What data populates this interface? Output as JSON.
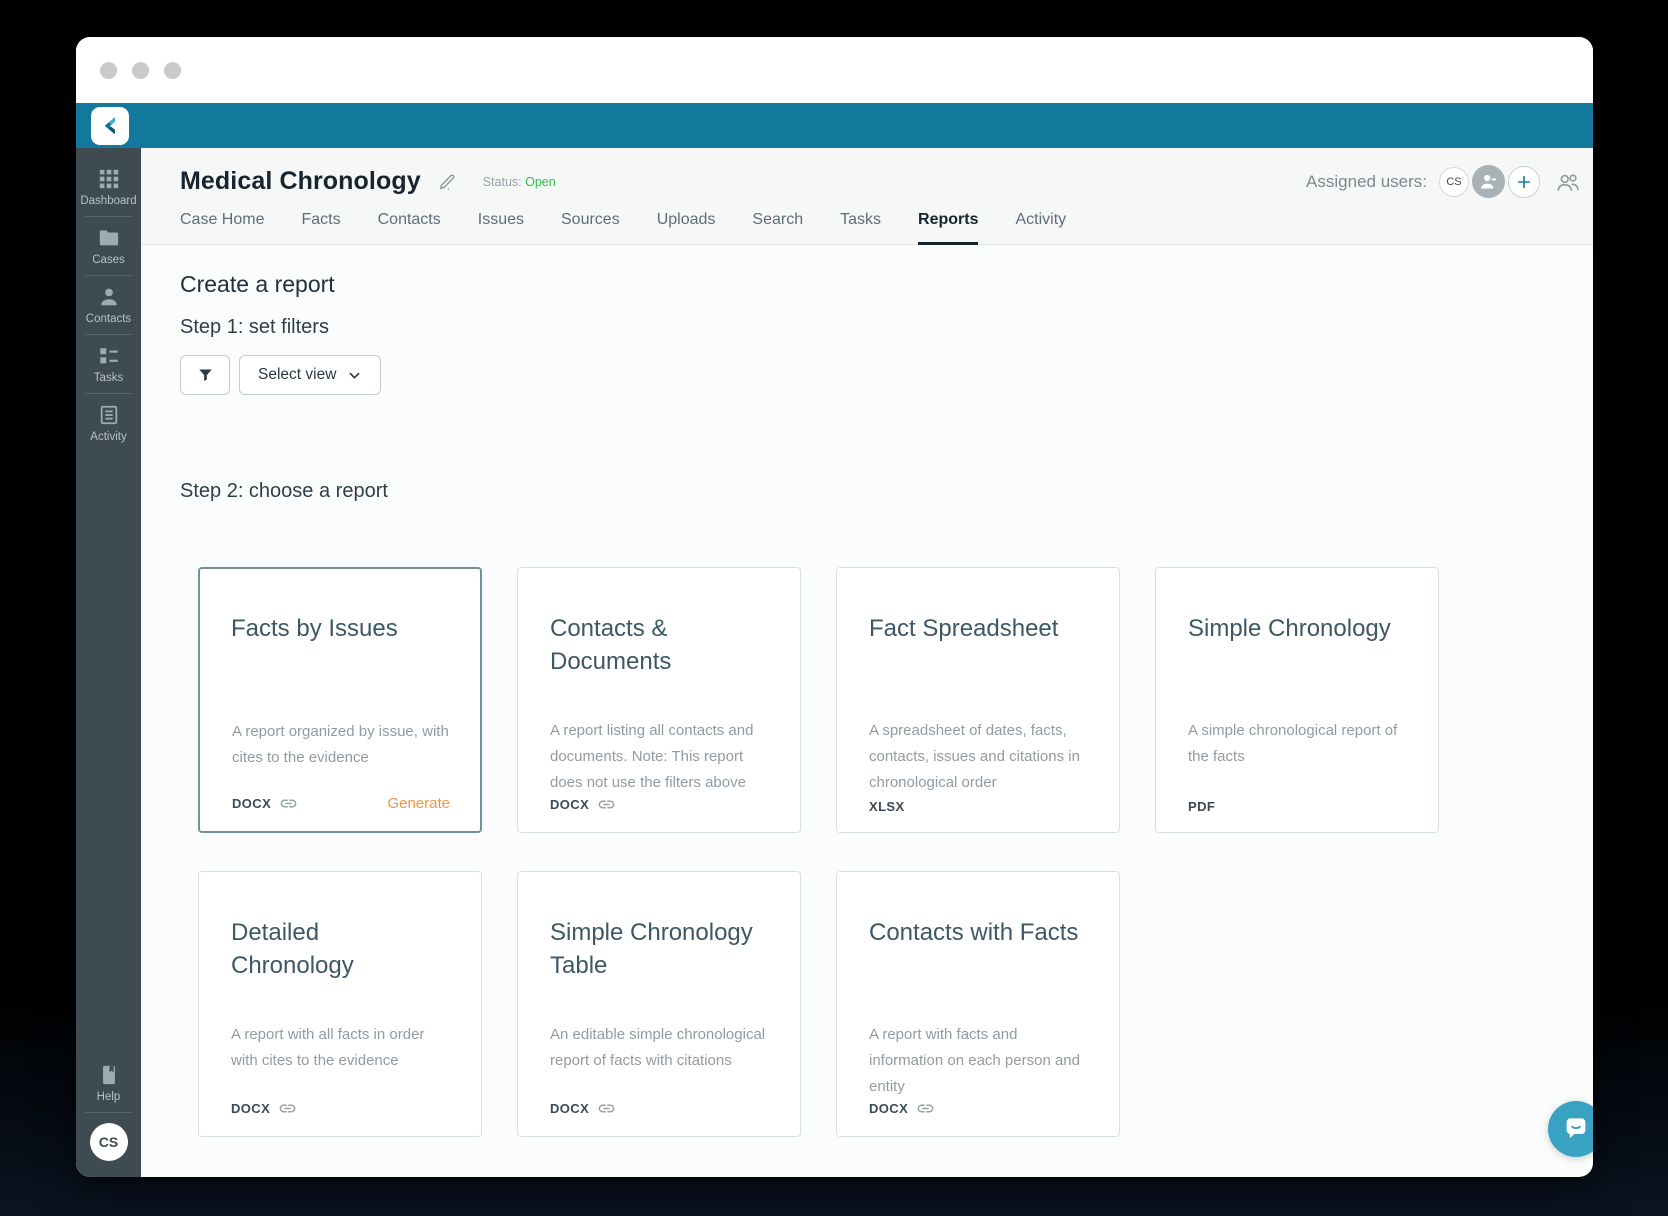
{
  "header": {
    "case_title": "Medical Chronology",
    "status_label": "Status:",
    "status_value": "Open",
    "assigned_users_label": "Assigned users:",
    "assigned_user_initials": "CS"
  },
  "tabs": [
    {
      "label": "Case Home"
    },
    {
      "label": "Facts"
    },
    {
      "label": "Contacts"
    },
    {
      "label": "Issues"
    },
    {
      "label": "Sources"
    },
    {
      "label": "Uploads"
    },
    {
      "label": "Search"
    },
    {
      "label": "Tasks"
    },
    {
      "label": "Reports"
    },
    {
      "label": "Activity"
    }
  ],
  "active_tab": "Reports",
  "sidebar": {
    "items": [
      {
        "label": "Dashboard",
        "icon": "grid-icon"
      },
      {
        "label": "Cases",
        "icon": "folder-icon"
      },
      {
        "label": "Contacts",
        "icon": "person-icon"
      },
      {
        "label": "Tasks",
        "icon": "tasks-icon"
      },
      {
        "label": "Activity",
        "icon": "activity-log-icon"
      }
    ],
    "help_label": "Help",
    "user_initials": "CS"
  },
  "content": {
    "page_title": "Create a report",
    "step1_heading": "Step 1: set filters",
    "select_view_label": "Select view",
    "step2_heading": "Step 2: choose a report"
  },
  "cards": [
    {
      "title": "Facts by Issues",
      "description": "A report organized by issue, with cites to the evidence",
      "format": "DOCX",
      "action_label": "Generate",
      "selected": true
    },
    {
      "title": "Contacts &\nDocuments",
      "description": "A report listing all contacts and documents. Note: This report does not use the filters above",
      "format": "DOCX"
    },
    {
      "title": "Fact Spreadsheet",
      "description": "A spreadsheet of dates, facts, contacts, issues and citations in chronological order",
      "format": "XLSX"
    },
    {
      "title": "Simple Chronology",
      "description": "A simple chronological report of the facts",
      "format": "PDF"
    },
    {
      "title": "Detailed\nChronology",
      "description": "A report with all facts in order with cites to the evidence",
      "format": "DOCX"
    },
    {
      "title": "Simple Chronology\nTable",
      "description": "An editable simple chronological report of facts with citations",
      "format": "DOCX"
    },
    {
      "title": "Contacts with Facts",
      "description": "A report with facts and information on each person and entity",
      "format": "DOCX"
    }
  ],
  "colors": {
    "brand_teal": "#13799c",
    "sidebar_dark": "#3e4b50",
    "status_open_green": "#2fc14b",
    "generate_orange": "#f4953f",
    "add_user_blue": "#15789d",
    "chat_teal": "#39a2c2"
  }
}
